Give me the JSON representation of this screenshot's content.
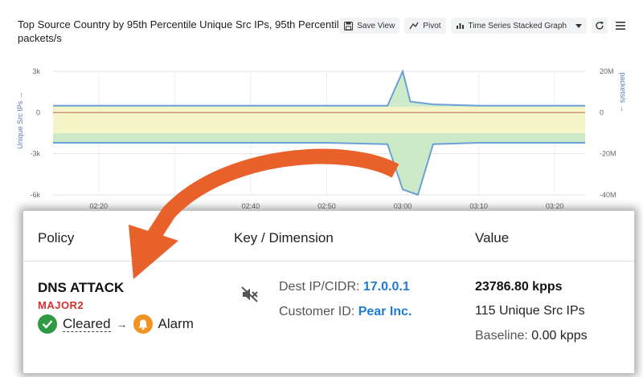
{
  "chart_panel": {
    "title": "Top Source Country by 95th Percentile Unique Src IPs, 95th Percentile packets/s",
    "toolbar": {
      "save_view": "Save View",
      "pivot": "Pivot",
      "graph_type": "Time Series Stacked Graph"
    }
  },
  "chart_data": {
    "type": "area",
    "ylabel_left": "Unique Src IPs →",
    "ylabel_right": "packets/s →",
    "left_ticks": [
      "3k",
      "0",
      "-3k",
      "-6k"
    ],
    "right_ticks": [
      "20M",
      "0",
      "-20M",
      "-40M"
    ],
    "x_ticks": [
      "02:20",
      "02:30",
      "02:40",
      "02:50",
      "03:00",
      "03:10",
      "03:20"
    ],
    "ylim_left": [
      -6000,
      3000
    ],
    "ylim_right": [
      -40000000,
      20000000
    ],
    "grid": true,
    "colors": {
      "band_green": "#c6e8c2",
      "band_yellow": "#f5f3c8",
      "line_blue": "#6b9fd8",
      "zero_line": "#c97a6a",
      "spike_fill": "#bfe3bb"
    },
    "series": [
      {
        "x": [
          "02:14",
          "02:20",
          "02:30",
          "02:40",
          "02:50",
          "02:58",
          "03:00",
          "03:01",
          "03:04",
          "03:10",
          "03:20",
          "03:24"
        ],
        "values": [
          500,
          500,
          500,
          500,
          500,
          500,
          3000,
          800,
          600,
          500,
          500,
          500
        ]
      },
      {
        "x": [
          "02:14",
          "02:20",
          "02:30",
          "02:40",
          "02:50",
          "02:58",
          "03:00",
          "03:02",
          "03:04",
          "03:10",
          "03:20",
          "03:24"
        ],
        "values": [
          -2200,
          -2200,
          -2200,
          -2200,
          -2200,
          -2300,
          -5600,
          -6000,
          -2300,
          -2200,
          -2200,
          -2200
        ]
      }
    ]
  },
  "card": {
    "headers": {
      "policy": "Policy",
      "key": "Key / Dimension",
      "value": "Value"
    },
    "policy_name": "DNS ATTACK",
    "severity": "MAJOR2",
    "state_from": "Cleared",
    "state_arrow": "→",
    "state_to": "Alarm",
    "dest_label": "Dest IP/CIDR: ",
    "dest_value": "17.0.0.1",
    "customer_label": "Customer ID: ",
    "customer_value": "Pear Inc.",
    "value_main": "23786.80 kpps",
    "value_sub": "115 Unique Src IPs",
    "baseline_label": "Baseline: ",
    "baseline_value": "0.00 kpps",
    "colors": {
      "cleared": "#2e9a44",
      "alarm": "#f19322",
      "arrow": "#e8602a"
    }
  }
}
